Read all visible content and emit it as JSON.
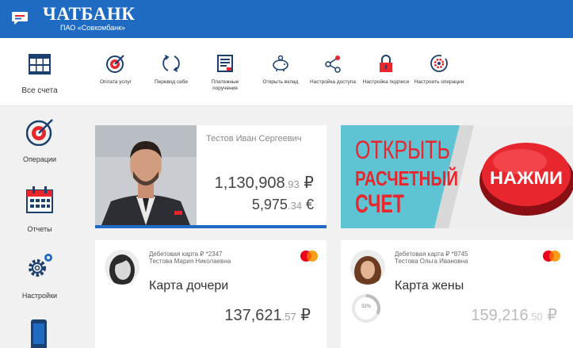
{
  "header": {
    "title": "ЧАТБАНК",
    "subtitle": "ПАО «Совкомбанк»"
  },
  "toolbar": {
    "all_accounts": "Все счета",
    "items": [
      {
        "label": "Оплата услуг",
        "icon": "target-icon"
      },
      {
        "label": "Перевод себе",
        "icon": "transfer-cycle-icon"
      },
      {
        "label": "Платежные поручения",
        "icon": "document-icon"
      },
      {
        "label": "Открыть вклад",
        "icon": "piggy-bank-icon"
      },
      {
        "label": "Настройка доступа",
        "icon": "share-icon"
      },
      {
        "label": "Настройка подписи",
        "icon": "lock-icon"
      },
      {
        "label": "Настроить операции",
        "icon": "gear-cycle-icon"
      }
    ]
  },
  "sidebar": {
    "items": [
      {
        "label": "Операции",
        "icon": "target-icon"
      },
      {
        "label": "Отчеты",
        "icon": "calendar-icon"
      },
      {
        "label": "Настройки",
        "icon": "gears-icon"
      },
      {
        "label": "",
        "icon": "phone-icon"
      }
    ]
  },
  "profile": {
    "name": "Тестов Иван Сергеевич",
    "rub_int": "1,130,908",
    "rub_dec": ".93",
    "rub_sym": " ₽",
    "eur_int": "5,975",
    "eur_dec": ".34",
    "eur_sym": " €"
  },
  "banner": {
    "line1": "ОТКРЫТЬ",
    "line2": "РАСЧЕТНЫЙ",
    "line3": "СЧЕТ",
    "button": "НАЖМИ"
  },
  "cards": [
    {
      "type": "Дебетовая карта ₽ *2347",
      "owner": "Тестова Мария Николаевна",
      "label": "Карта дочери",
      "bal_int": "137,621",
      "bal_dec": ".57",
      "bal_sym": " ₽"
    },
    {
      "type": "Дебетовая карта ₽ *8745",
      "owner": "Тестова Ольга Ивановна",
      "label": "Карта жены",
      "bal_int": "159,216",
      "bal_dec": ".50",
      "bal_sym": " ₽",
      "progress_label": "32%",
      "progress_value": 0.32
    }
  ],
  "colors": {
    "header_blue": "#1f6bc4",
    "accent_red": "#e8262d",
    "banner_teal": "#5ec3d3",
    "text_dark": "#333333"
  }
}
